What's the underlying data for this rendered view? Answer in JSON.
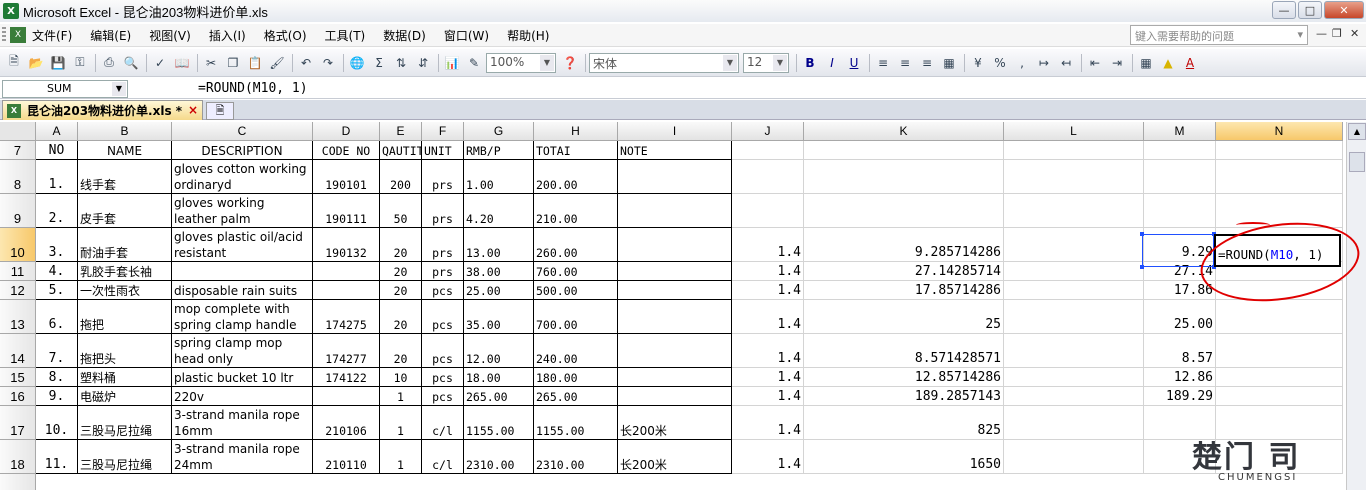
{
  "window": {
    "title": "Microsoft Excel - 昆仑油203物料进价单.xls",
    "app_icon": "excel-icon",
    "buttons": [
      "minimize",
      "maximize",
      "close"
    ]
  },
  "menu": {
    "items": [
      "文件(F)",
      "编辑(E)",
      "视图(V)",
      "插入(I)",
      "格式(O)",
      "工具(T)",
      "数据(D)",
      "窗口(W)",
      "帮助(H)"
    ],
    "help_placeholder": "键入需要帮助的问题"
  },
  "toolbar": {
    "zoom": "100%",
    "font": "宋体",
    "font_size": "12",
    "bold": "B",
    "italic": "I",
    "underline": "U",
    "autosum": "Σ",
    "percent": "%",
    "comma": ","
  },
  "formula_bar": {
    "name_box": "SUM",
    "formula": "=ROUND(M10, 1)"
  },
  "doc_tab": {
    "label": "昆仑油203物料进价单.xls *",
    "close": "×"
  },
  "columns": [
    "A",
    "B",
    "C",
    "D",
    "E",
    "F",
    "G",
    "H",
    "I",
    "J",
    "K",
    "L",
    "M",
    "N"
  ],
  "header_row": {
    "row": "7",
    "cells": [
      "NO",
      "NAME",
      "DESCRIPTION",
      "CODE NO",
      "QAUTITY",
      "UNIT",
      "RMB/P",
      "TOTAI",
      "NOTE"
    ]
  },
  "rows": [
    {
      "row": "8",
      "no": "1.",
      "name": "线手套",
      "desc": "gloves cotton working ordinaryd",
      "code": "190101",
      "qty": "200",
      "unit": "prs",
      "price": "1.00",
      "total": "200.00",
      "note": "",
      "j": "",
      "k": "",
      "m": ""
    },
    {
      "row": "9",
      "no": "2.",
      "name": "皮手套",
      "desc": "gloves  working leather palm",
      "code": "190111",
      "qty": "50",
      "unit": "prs",
      "price": "4.20",
      "total": "210.00",
      "note": "",
      "j": "",
      "k": "",
      "m": ""
    },
    {
      "row": "10",
      "no": "3.",
      "name": "耐油手套",
      "desc": "gloves plastic oil/acid resistant",
      "code": "190132",
      "qty": "20",
      "unit": "prs",
      "price": "13.00",
      "total": "260.00",
      "note": "",
      "j": "1.4",
      "k": "9.285714286",
      "m": "9.29"
    },
    {
      "row": "11",
      "no": "4.",
      "name": "乳胶手套长袖",
      "desc": "",
      "code": "",
      "qty": "20",
      "unit": "prs",
      "price": "38.00",
      "total": "760.00",
      "note": "",
      "j": "1.4",
      "k": "27.14285714",
      "m": "27.14"
    },
    {
      "row": "12",
      "no": "5.",
      "name": "一次性雨衣",
      "desc": "disposable rain suits",
      "code": "",
      "qty": "20",
      "unit": "pcs",
      "price": "25.00",
      "total": "500.00",
      "note": "",
      "j": "1.4",
      "k": "17.85714286",
      "m": "17.86"
    },
    {
      "row": "13",
      "no": "6.",
      "name": "拖把",
      "desc": "mop complete with spring clamp handle",
      "code": "174275",
      "qty": "20",
      "unit": "pcs",
      "price": "35.00",
      "total": "700.00",
      "note": "",
      "j": "1.4",
      "k": "25",
      "m": "25.00"
    },
    {
      "row": "14",
      "no": "7.",
      "name": "拖把头",
      "desc": " spring clamp mop head only",
      "code": "174277",
      "qty": "20",
      "unit": "pcs",
      "price": "12.00",
      "total": "240.00",
      "note": "",
      "j": "1.4",
      "k": "8.571428571",
      "m": "8.57"
    },
    {
      "row": "15",
      "no": "8.",
      "name": "塑料桶",
      "desc": "plastic bucket 10 ltr",
      "code": "174122",
      "qty": "10",
      "unit": "pcs",
      "price": "18.00",
      "total": "180.00",
      "note": "",
      "j": "1.4",
      "k": "12.85714286",
      "m": "12.86"
    },
    {
      "row": "16",
      "no": "9.",
      "name": "电磁炉",
      "desc": "220v",
      "code": "",
      "qty": "1",
      "unit": "pcs",
      "price": "265.00",
      "total": "265.00",
      "note": "",
      "j": "1.4",
      "k": "189.2857143",
      "m": "189.29"
    },
    {
      "row": "17",
      "no": "10.",
      "name": "三股马尼拉绳",
      "desc": "3-strand manila rope 16mm",
      "code": "210106",
      "qty": "1",
      "unit": "c/l",
      "price": "1155.00",
      "total": "1155.00",
      "note": "长200米",
      "j": "1.4",
      "k": "825",
      "m": ""
    },
    {
      "row": "18",
      "no": "11.",
      "name": "三股马尼拉绳",
      "desc": "3-strand manila rope 24mm",
      "code": "210110",
      "qty": "1",
      "unit": "c/l",
      "price": "2310.00",
      "total": "2310.00",
      "note": "长200米",
      "j": "1.4",
      "k": "1650",
      "m": ""
    }
  ],
  "editing": {
    "prefix": "=ROUND(",
    "ref": "M10",
    "suffix": ", 1)"
  },
  "watermark": {
    "main": "楚门 司",
    "sub": "CHUMENGSI"
  }
}
